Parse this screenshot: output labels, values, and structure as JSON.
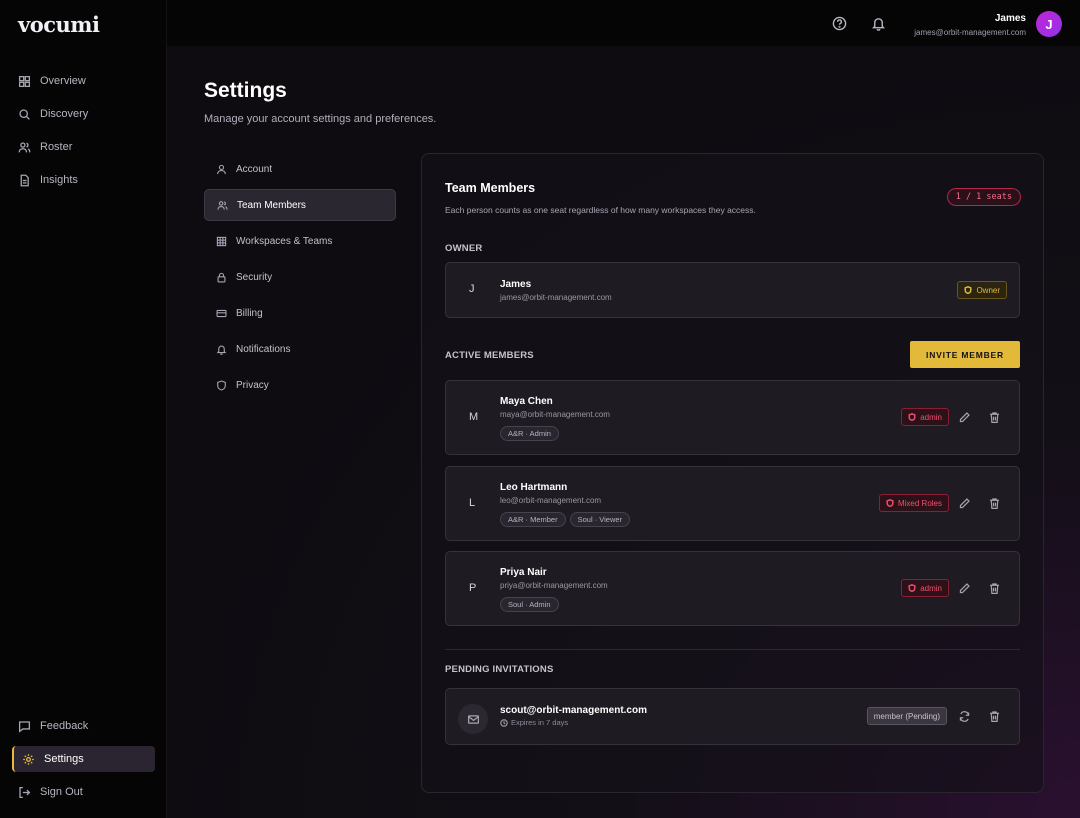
{
  "app": {
    "logo": "vocumi"
  },
  "sidebar": {
    "items": [
      {
        "label": "Overview",
        "icon": "grid-icon"
      },
      {
        "label": "Discovery",
        "icon": "search-icon"
      },
      {
        "label": "Roster",
        "icon": "users-icon"
      },
      {
        "label": "Insights",
        "icon": "document-icon"
      }
    ],
    "bottom_items": [
      {
        "label": "Feedback",
        "icon": "message-icon"
      },
      {
        "label": "Settings",
        "icon": "gear-icon",
        "active": true
      },
      {
        "label": "Sign Out",
        "icon": "sign-out-icon"
      }
    ]
  },
  "header": {
    "user_name": "James",
    "user_email": "james@orbit-management.com",
    "avatar_initial": "J"
  },
  "page": {
    "title": "Settings",
    "subtitle": "Manage your account settings and preferences."
  },
  "settings_nav": [
    {
      "label": "Account",
      "icon": "user-icon"
    },
    {
      "label": "Team Members",
      "icon": "users-icon",
      "active": true
    },
    {
      "label": "Workspaces & Teams",
      "icon": "grid-icon"
    },
    {
      "label": "Security",
      "icon": "lock-icon"
    },
    {
      "label": "Billing",
      "icon": "credit-card-icon"
    },
    {
      "label": "Notifications",
      "icon": "bell-icon"
    },
    {
      "label": "Privacy",
      "icon": "shield-icon"
    }
  ],
  "team": {
    "title": "Team Members",
    "description": "Each person counts as one seat regardless of how many workspaces they access.",
    "seats": "1 / 1 seats",
    "owner_label": "OWNER",
    "owner": {
      "initial": "J",
      "name": "James",
      "email": "james@orbit-management.com",
      "role": "Owner"
    },
    "active_label": "ACTIVE MEMBERS",
    "invite_button": "INVITE MEMBER",
    "members": [
      {
        "initial": "M",
        "name": "Maya Chen",
        "email": "maya@orbit-management.com",
        "tags": [
          "A&R · Admin"
        ],
        "role": "admin"
      },
      {
        "initial": "L",
        "name": "Leo Hartmann",
        "email": "leo@orbit-management.com",
        "tags": [
          "A&R · Member",
          "Soul · Viewer"
        ],
        "role": "Mixed Roles"
      },
      {
        "initial": "P",
        "name": "Priya Nair",
        "email": "priya@orbit-management.com",
        "tags": [
          "Soul · Admin"
        ],
        "role": "admin"
      }
    ],
    "pending_label": "PENDING INVITATIONS",
    "pending": [
      {
        "email": "scout@orbit-management.com",
        "expires": "Expires in 7 days",
        "status": "member (Pending)"
      }
    ]
  },
  "colors": {
    "accent": "#e3b93a",
    "danger": "#ef4f6e",
    "avatar": "#c026d3"
  }
}
